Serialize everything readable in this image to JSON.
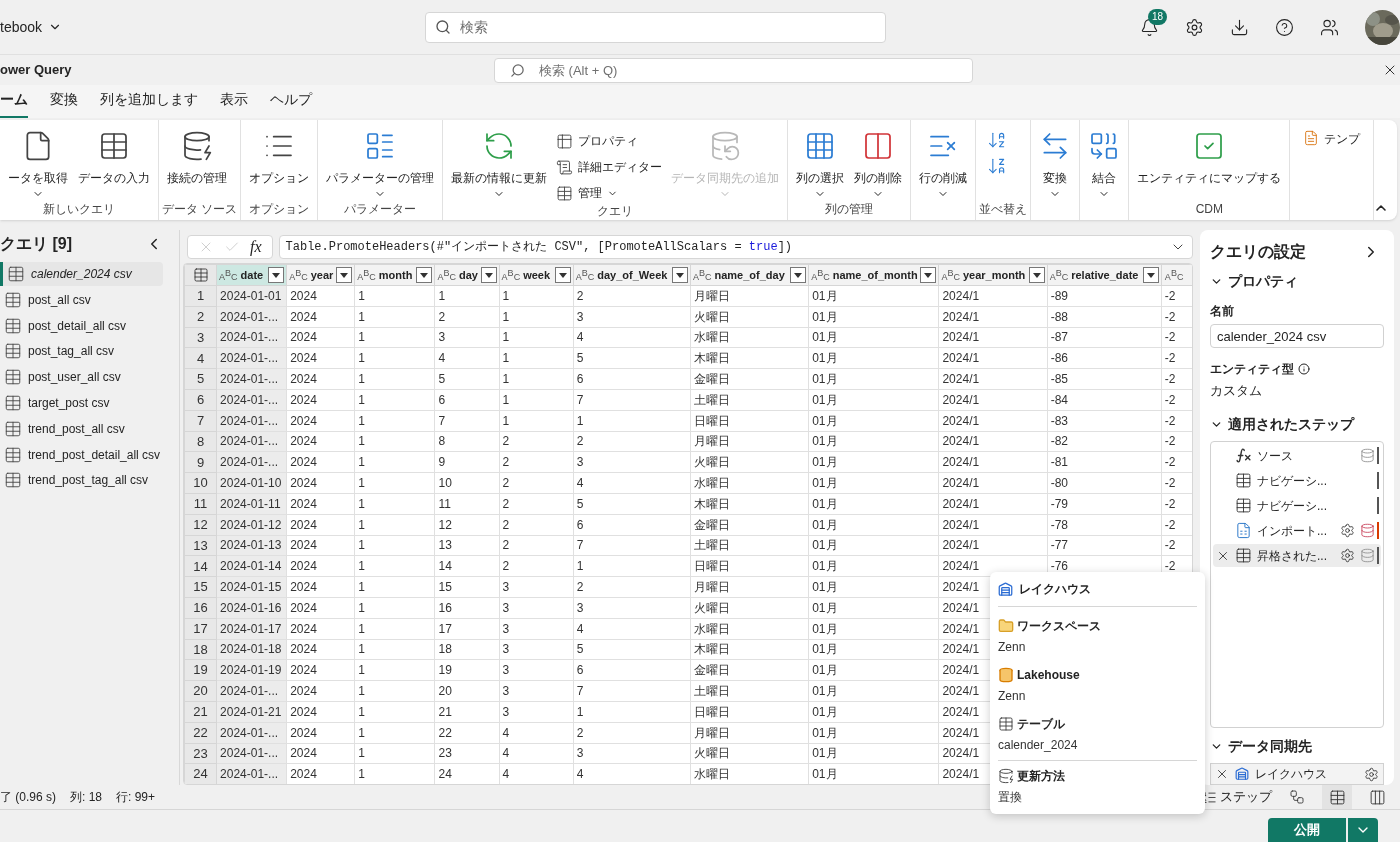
{
  "app": {
    "title": "tebook",
    "search_placeholder": "検索",
    "notification_count": "18"
  },
  "editor": {
    "title": "ower Query",
    "search_placeholder": "検索 (Alt + Q)"
  },
  "tabs": [
    {
      "label": "ーム",
      "selected": true
    },
    {
      "label": "変換",
      "selected": false
    },
    {
      "label": "列を追加します",
      "selected": false
    },
    {
      "label": "表示",
      "selected": false
    },
    {
      "label": "ヘルプ",
      "selected": false
    }
  ],
  "ribbon": [
    {
      "label": "新しいクエリ",
      "items": [
        {
          "kind": "large",
          "label": "ータを取得",
          "caret": true,
          "disabled": false
        },
        {
          "kind": "large",
          "label": "データの入力",
          "caret": false,
          "disabled": false
        }
      ]
    },
    {
      "label": "データ ソース",
      "items": [
        {
          "kind": "large",
          "label": "接続の管理",
          "caret": false,
          "disabled": false
        }
      ]
    },
    {
      "label": "オプション",
      "items": [
        {
          "kind": "large",
          "label": "オプション",
          "caret": false,
          "disabled": false
        }
      ]
    },
    {
      "label": "パラメーター",
      "items": [
        {
          "kind": "large",
          "label": "パラメーターの管理",
          "caret": true,
          "disabled": false
        }
      ]
    },
    {
      "label": "クエリ",
      "items": [
        {
          "kind": "large",
          "label": "最新の情報に更新",
          "caret": true,
          "disabled": false
        },
        {
          "kind": "stack",
          "items": [
            {
              "label": "プロパティ",
              "caret": false
            },
            {
              "label": "詳細エディター",
              "caret": false
            },
            {
              "label": "管理",
              "caret": true
            }
          ]
        },
        {
          "kind": "large",
          "label": "データ同期先の追加",
          "caret": true,
          "disabled": true
        }
      ]
    },
    {
      "label": "列の管理",
      "items": [
        {
          "kind": "large",
          "label": "列の選択",
          "caret": true,
          "disabled": false
        },
        {
          "kind": "large",
          "label": "列の削除",
          "caret": true,
          "disabled": false
        }
      ]
    },
    {
      "items": [
        {
          "kind": "large",
          "label": "行の削減",
          "caret": true,
          "disabled": false
        }
      ]
    },
    {
      "label": "並べ替え",
      "items": [
        {
          "kind": "sort"
        }
      ]
    },
    {
      "items": [
        {
          "kind": "large",
          "label": "変換",
          "caret": true,
          "disabled": false
        }
      ]
    },
    {
      "items": [
        {
          "kind": "large",
          "label": "結合",
          "caret": true,
          "disabled": false
        }
      ]
    },
    {
      "label": "CDM",
      "items": [
        {
          "kind": "large",
          "label": "エンティティにマップする",
          "caret": false,
          "disabled": false
        }
      ]
    },
    {
      "items": [
        {
          "kind": "small",
          "label": "テンプ"
        }
      ]
    }
  ],
  "queries": {
    "title": "クエリ [9]",
    "items": [
      {
        "label": "calender_2024 csv",
        "selected": true
      },
      {
        "label": "post_all csv",
        "selected": false
      },
      {
        "label": "post_detail_all csv",
        "selected": false
      },
      {
        "label": "post_tag_all csv",
        "selected": false
      },
      {
        "label": "post_user_all csv",
        "selected": false
      },
      {
        "label": "target_post csv",
        "selected": false
      },
      {
        "label": "trend_post_all csv",
        "selected": false
      },
      {
        "label": "trend_post_detail_all csv",
        "selected": false
      },
      {
        "label": "trend_post_tag_all csv",
        "selected": false
      }
    ]
  },
  "formula_bar": {
    "fx": "fx",
    "parts": [
      {
        "kind": "plain",
        "text": "Table.PromoteHeaders(#\"インポートされた CSV\", [PromoteAllScalars = "
      },
      {
        "kind": "keyword",
        "text": "true"
      },
      {
        "kind": "plain",
        "text": "])"
      }
    ]
  },
  "table": {
    "columns": [
      {
        "type": "ABC",
        "label": "date",
        "selected": true
      },
      {
        "type": "ABC",
        "label": "year",
        "selected": false
      },
      {
        "type": "ABC",
        "label": "month",
        "selected": false
      },
      {
        "type": "ABC",
        "label": "day",
        "selected": false
      },
      {
        "type": "ABC",
        "label": "week",
        "selected": false
      },
      {
        "type": "ABC",
        "label": "day_of_Week",
        "selected": false
      },
      {
        "type": "ABC",
        "label": "name_of_day",
        "selected": false
      },
      {
        "type": "ABC",
        "label": "name_of_month",
        "selected": false
      },
      {
        "type": "ABC",
        "label": "year_month",
        "selected": false
      },
      {
        "type": "ABC",
        "label": "relative_date",
        "selected": false
      },
      {
        "type": "ABC",
        "selected": false
      }
    ],
    "rows": [
      {
        "number": "1",
        "cells": [
          "2024-01-01",
          "2024",
          "1",
          "1",
          "1",
          "2",
          "月曜日",
          "01月",
          "2024/1",
          "-89",
          "-2"
        ]
      },
      {
        "number": "2",
        "cells": [
          "2024-01-...",
          "2024",
          "1",
          "2",
          "1",
          "3",
          "火曜日",
          "01月",
          "2024/1",
          "-88",
          "-2"
        ]
      },
      {
        "number": "3",
        "cells": [
          "2024-01-...",
          "2024",
          "1",
          "3",
          "1",
          "4",
          "水曜日",
          "01月",
          "2024/1",
          "-87",
          "-2"
        ]
      },
      {
        "number": "4",
        "cells": [
          "2024-01-...",
          "2024",
          "1",
          "4",
          "1",
          "5",
          "木曜日",
          "01月",
          "2024/1",
          "-86",
          "-2"
        ]
      },
      {
        "number": "5",
        "cells": [
          "2024-01-...",
          "2024",
          "1",
          "5",
          "1",
          "6",
          "金曜日",
          "01月",
          "2024/1",
          "-85",
          "-2"
        ]
      },
      {
        "number": "6",
        "cells": [
          "2024-01-...",
          "2024",
          "1",
          "6",
          "1",
          "7",
          "土曜日",
          "01月",
          "2024/1",
          "-84",
          "-2"
        ]
      },
      {
        "number": "7",
        "cells": [
          "2024-01-...",
          "2024",
          "1",
          "7",
          "1",
          "1",
          "日曜日",
          "01月",
          "2024/1",
          "-83",
          "-2"
        ]
      },
      {
        "number": "8",
        "cells": [
          "2024-01-...",
          "2024",
          "1",
          "8",
          "2",
          "2",
          "月曜日",
          "01月",
          "2024/1",
          "-82",
          "-2"
        ]
      },
      {
        "number": "9",
        "cells": [
          "2024-01-...",
          "2024",
          "1",
          "9",
          "2",
          "3",
          "火曜日",
          "01月",
          "2024/1",
          "-81",
          "-2"
        ]
      },
      {
        "number": "10",
        "cells": [
          "2024-01-10",
          "2024",
          "1",
          "10",
          "2",
          "4",
          "水曜日",
          "01月",
          "2024/1",
          "-80",
          "-2"
        ]
      },
      {
        "number": "11",
        "cells": [
          "2024-01-11",
          "2024",
          "1",
          "11",
          "2",
          "5",
          "木曜日",
          "01月",
          "2024/1",
          "-79",
          "-2"
        ]
      },
      {
        "number": "12",
        "cells": [
          "2024-01-12",
          "2024",
          "1",
          "12",
          "2",
          "6",
          "金曜日",
          "01月",
          "2024/1",
          "-78",
          "-2"
        ]
      },
      {
        "number": "13",
        "cells": [
          "2024-01-13",
          "2024",
          "1",
          "13",
          "2",
          "7",
          "土曜日",
          "01月",
          "2024/1",
          "-77",
          "-2"
        ]
      },
      {
        "number": "14",
        "cells": [
          "2024-01-14",
          "2024",
          "1",
          "14",
          "2",
          "1",
          "日曜日",
          "01月",
          "2024/1",
          "-76",
          "-2"
        ]
      },
      {
        "number": "15",
        "cells": [
          "2024-01-15",
          "2024",
          "1",
          "15",
          "3",
          "2",
          "月曜日",
          "01月",
          "2024/1"
        ]
      },
      {
        "number": "16",
        "cells": [
          "2024-01-16",
          "2024",
          "1",
          "16",
          "3",
          "3",
          "火曜日",
          "01月",
          "2024/1"
        ]
      },
      {
        "number": "17",
        "cells": [
          "2024-01-17",
          "2024",
          "1",
          "17",
          "3",
          "4",
          "水曜日",
          "01月",
          "2024/1"
        ]
      },
      {
        "number": "18",
        "cells": [
          "2024-01-18",
          "2024",
          "1",
          "18",
          "3",
          "5",
          "木曜日",
          "01月",
          "2024/1"
        ]
      },
      {
        "number": "19",
        "cells": [
          "2024-01-19",
          "2024",
          "1",
          "19",
          "3",
          "6",
          "金曜日",
          "01月",
          "2024/1"
        ]
      },
      {
        "number": "20",
        "cells": [
          "2024-01-...",
          "2024",
          "1",
          "20",
          "3",
          "7",
          "土曜日",
          "01月",
          "2024/1"
        ]
      },
      {
        "number": "21",
        "cells": [
          "2024-01-21",
          "2024",
          "1",
          "21",
          "3",
          "1",
          "日曜日",
          "01月",
          "2024/1"
        ]
      },
      {
        "number": "22",
        "cells": [
          "2024-01-...",
          "2024",
          "1",
          "22",
          "4",
          "2",
          "月曜日",
          "01月",
          "2024/1"
        ]
      },
      {
        "number": "23",
        "cells": [
          "2024-01-...",
          "2024",
          "1",
          "23",
          "4",
          "3",
          "火曜日",
          "01月",
          "2024/1"
        ]
      },
      {
        "number": "24",
        "cells": [
          "2024-01-...",
          "2024",
          "1",
          "24",
          "4",
          "4",
          "水曜日",
          "01月",
          "2024/1"
        ]
      }
    ]
  },
  "settings": {
    "title": "クエリの設定",
    "properties": {
      "title": "プロパティ",
      "expanded": true,
      "name_label": "名前",
      "name_value": "calender_2024 csv",
      "entity_label": "エンティティ型",
      "entity_value": "カスタム"
    },
    "steps": {
      "title": "適用されたステップ",
      "expanded": true,
      "items": [
        {
          "kind": "function",
          "label": "ソース",
          "selected": false,
          "gear": false,
          "cached": true,
          "warning": false
        },
        {
          "kind": "table",
          "label": "ナビゲーシ...",
          "selected": false,
          "gear": false,
          "cached": false,
          "warning": false
        },
        {
          "kind": "table",
          "label": "ナビゲーシ...",
          "selected": false,
          "gear": false,
          "cached": false,
          "warning": false
        },
        {
          "kind": "csv",
          "label": "インポート...",
          "selected": false,
          "gear": true,
          "cached": true,
          "warning": true
        },
        {
          "kind": "table",
          "label": "昇格された...",
          "selected": true,
          "gear": true,
          "cached": true,
          "warning": false
        }
      ]
    },
    "destination": {
      "title": "データ同期先",
      "expanded": true,
      "label": "レイクハウス"
    }
  },
  "status_bar": {
    "items": [
      "了 (0.96 s)",
      "列: 18",
      "行: 99+"
    ],
    "steps_label": "ステップ",
    "views": [
      {
        "kind": "diagram",
        "selected": false
      },
      {
        "kind": "table",
        "selected": true
      },
      {
        "kind": "schema",
        "selected": false
      }
    ]
  },
  "popup": {
    "title": "レイクハウス",
    "sections": [
      {
        "kind": "folder",
        "label": "ワークスペース",
        "value": "Zenn",
        "divider": false
      },
      {
        "kind": "lakehouse",
        "label": "Lakehouse",
        "value": "Zenn",
        "divider": false
      },
      {
        "kind": "table",
        "label": "テーブル",
        "value": "calender_2024",
        "divider": false
      },
      {
        "kind": "refresh",
        "label": "更新方法",
        "value": "置換",
        "divider": true
      }
    ]
  },
  "publish": {
    "label": "公開"
  }
}
